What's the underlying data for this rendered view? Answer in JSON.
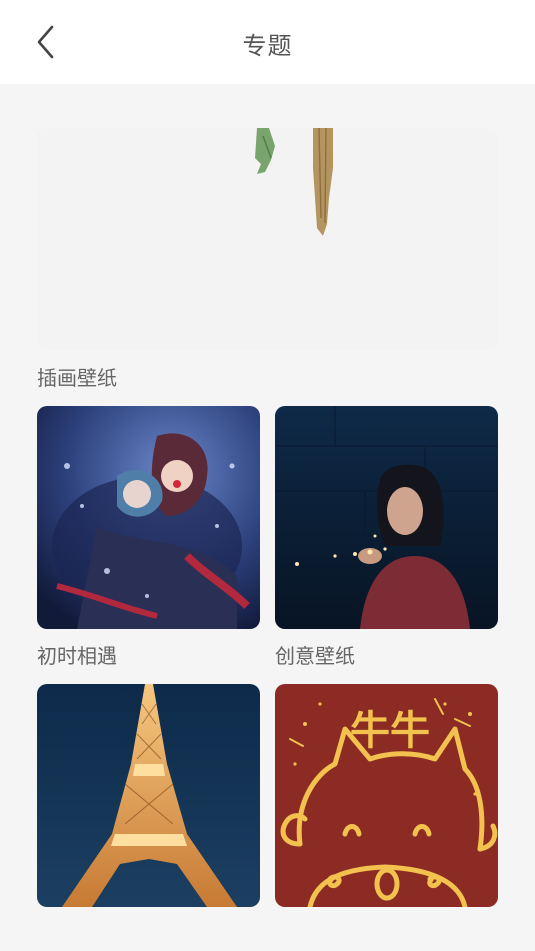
{
  "header": {
    "title": "专题",
    "back_icon": "chevron-left-icon"
  },
  "sections": [
    {
      "label": "插画壁纸"
    },
    {
      "label": "初时相遇"
    },
    {
      "label": "创意壁纸"
    }
  ],
  "cards": [
    {
      "name": "illustration-banner",
      "section": "插画壁纸"
    },
    {
      "name": "anime-couple",
      "section": "初时相遇"
    },
    {
      "name": "woman-lights",
      "section": "创意壁纸"
    },
    {
      "name": "eiffel-tower"
    },
    {
      "name": "cow-doodle",
      "text": "牛牛",
      "colors": {
        "bg": "#8b2b23",
        "line": "#f2c14e"
      }
    }
  ]
}
